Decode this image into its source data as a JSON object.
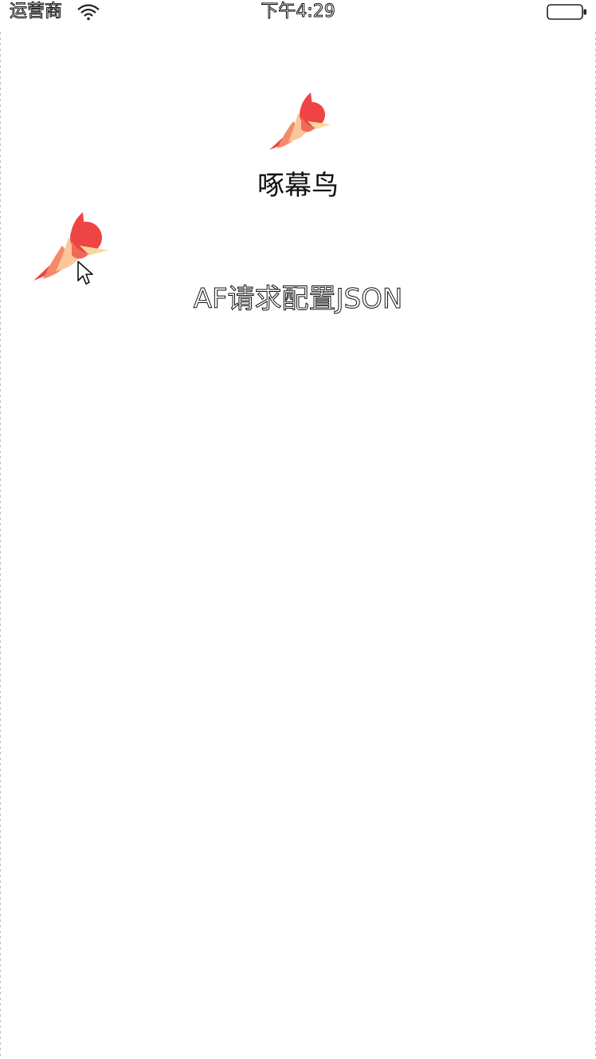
{
  "status_bar": {
    "carrier": "运营商",
    "time": "下午4:29",
    "wifi_icon": "wifi-icon",
    "battery_icon": "battery-icon"
  },
  "header": {
    "logo_icon": "woodpecker-logo-icon",
    "title": "啄幕鸟"
  },
  "menu": {
    "items": [
      {
        "label": "AF请求配置JSON"
      }
    ]
  },
  "floating": {
    "bird_icon": "woodpecker-bird-icon",
    "cursor_icon": "mouse-pointer-icon"
  },
  "colors": {
    "bird_red": "#ef4444",
    "bird_orange": "#f59a74",
    "bird_peach": "#fbc79a",
    "bird_beak": "#f8d8a0",
    "background": "#ffffff"
  }
}
